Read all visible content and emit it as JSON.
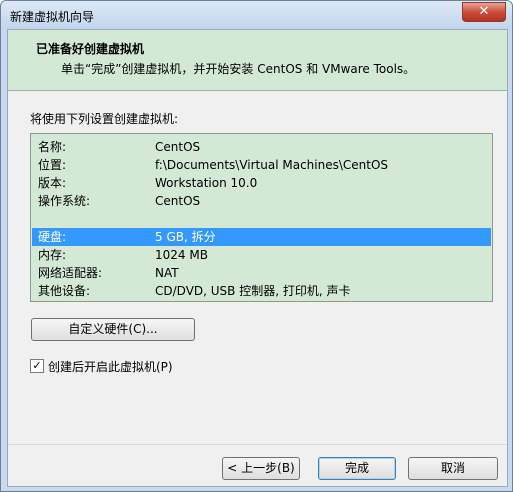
{
  "window": {
    "title": "新建虚拟机向导",
    "close_label": "✕"
  },
  "header": {
    "title": "已准备好创建虚拟机",
    "subtitle": "单击“完成”创建虚拟机，并开始安装 CentOS 和 VMware Tools。"
  },
  "intro": "将使用下列设置创建虚拟机:",
  "summary": {
    "rows": [
      {
        "key": "名称:",
        "value": "CentOS"
      },
      {
        "key": "位置:",
        "value": "f:\\Documents\\Virtual Machines\\CentOS"
      },
      {
        "key": "版本:",
        "value": "Workstation 10.0"
      },
      {
        "key": "操作系统:",
        "value": "CentOS"
      },
      {
        "key": "硬盘:",
        "value": "5 GB, 拆分",
        "selected": true
      },
      {
        "key": "内存:",
        "value": "1024 MB"
      },
      {
        "key": "网络适配器:",
        "value": "NAT"
      },
      {
        "key": "其他设备:",
        "value": "CD/DVD, USB 控制器, 打印机, 声卡"
      }
    ]
  },
  "buttons": {
    "customize": "自定义硬件(C)...",
    "back": "< 上一步(B)",
    "finish": "完成",
    "cancel": "取消"
  },
  "power_on": {
    "label": "创建后开启此虚拟机(P)",
    "checked": true
  }
}
